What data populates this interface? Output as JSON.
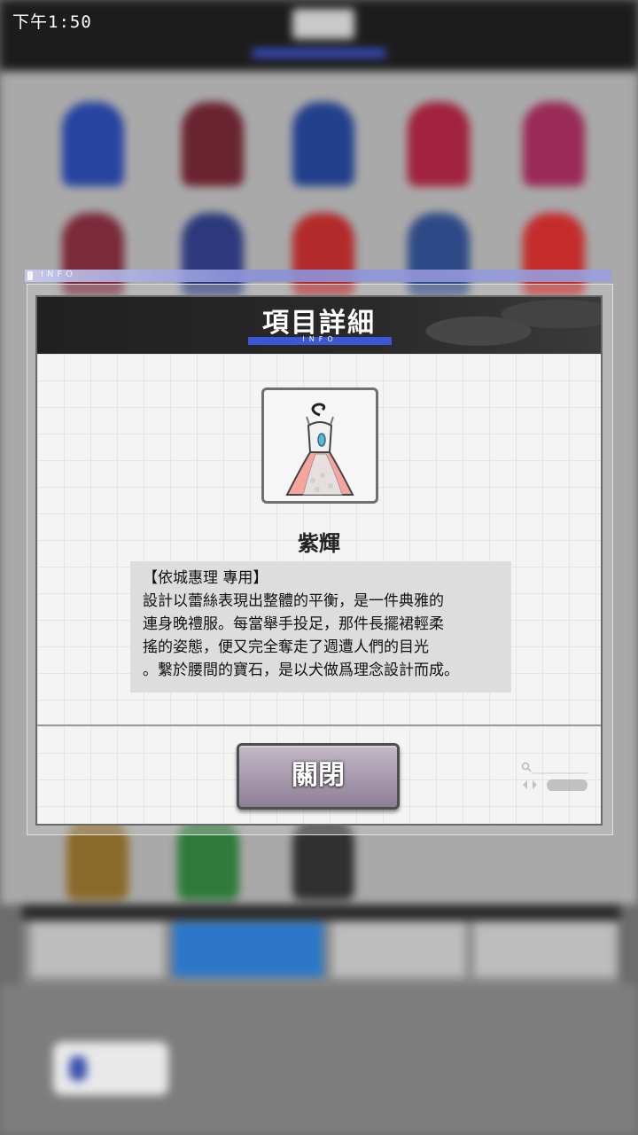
{
  "status_bar": {
    "time": "下午1:50"
  },
  "dialog": {
    "tag": "INFO",
    "title": "項目詳細",
    "title_subtag": "INFO",
    "item": {
      "image_icon": "dress-icon",
      "name": "紫輝",
      "description_lines": [
        "【依城惠理 專用】",
        "設計以蕾絲表現出整體的平衡，是一件典雅的",
        "連身晚禮服。每當舉手投足，那件長擺裙輕柔",
        "搖的姿態，便又完全奪走了週遭人們的目光",
        "。繫於腰間的寶石，是以犬做爲理念設計而成。"
      ]
    },
    "close_label": "關閉"
  },
  "colors": {
    "accent_blue": "#3e55d6",
    "header_bg": "#202020",
    "close_button": "#a99bae"
  }
}
